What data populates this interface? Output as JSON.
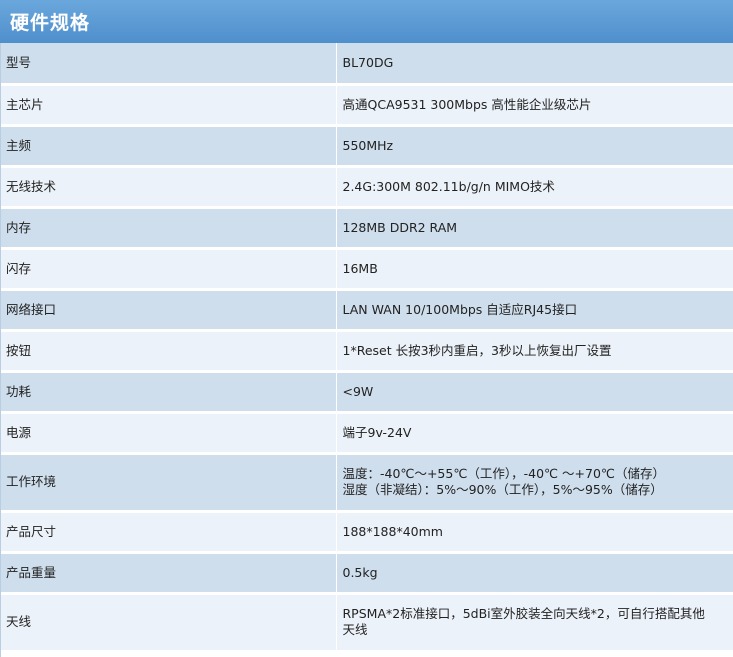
{
  "header": {
    "title": "硬件规格"
  },
  "rows": [
    {
      "label": "型号",
      "value": [
        "BL70DG"
      ]
    },
    {
      "label": "主芯片",
      "value": [
        "高通QCA9531 300Mbps 高性能企业级芯片"
      ]
    },
    {
      "label": "主频",
      "value": [
        "550MHz"
      ]
    },
    {
      "label": "无线技术",
      "value": [
        "2.4G:300M 802.11b/g/n MIMO技术"
      ]
    },
    {
      "label": "内存",
      "value": [
        "128MB DDR2 RAM"
      ]
    },
    {
      "label": "闪存",
      "value": [
        "16MB"
      ]
    },
    {
      "label": "网络接口",
      "value": [
        "LAN WAN 10/100Mbps 自适应RJ45接口"
      ]
    },
    {
      "label": "按钮",
      "value": [
        "1*Reset 长按3秒内重启，3秒以上恢复出厂设置"
      ]
    },
    {
      "label": "功耗",
      "value": [
        "<9W"
      ]
    },
    {
      "label": "电源",
      "value": [
        "端子9v-24V"
      ]
    },
    {
      "label": "工作环境",
      "value": [
        "温度：-40℃～+55℃（工作），-40℃ ～+70℃（储存）",
        "湿度（非凝结）：5%～90%（工作），5%～95%（储存）"
      ]
    },
    {
      "label": "产品尺寸",
      "value": [
        "188*188*40mm"
      ]
    },
    {
      "label": "产品重量",
      "value": [
        "0.5kg"
      ]
    },
    {
      "label": "天线",
      "value": [
        "RPSMA*2标准接口，5dBi室外胶装全向天线*2，可自行搭配其他",
        "天线"
      ]
    }
  ]
}
